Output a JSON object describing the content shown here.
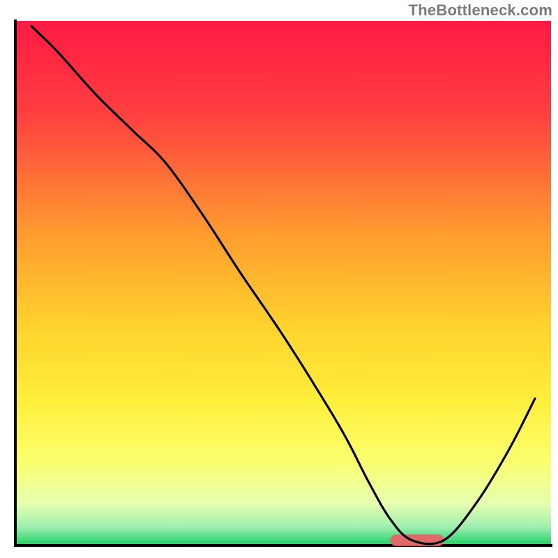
{
  "watermark": "TheBottleneck.com",
  "chart_data": {
    "type": "line",
    "title": "",
    "xlabel": "",
    "ylabel": "",
    "xlim": [
      0,
      100
    ],
    "ylim": [
      0,
      100
    ],
    "legend": false,
    "grid": false,
    "background_gradient": {
      "stops": [
        {
          "offset": 0.0,
          "color": "#ff1a44"
        },
        {
          "offset": 0.18,
          "color": "#ff4040"
        },
        {
          "offset": 0.4,
          "color": "#ff9a2f"
        },
        {
          "offset": 0.58,
          "color": "#ffd22e"
        },
        {
          "offset": 0.72,
          "color": "#ffee3a"
        },
        {
          "offset": 0.84,
          "color": "#fbff6e"
        },
        {
          "offset": 0.92,
          "color": "#e6ffb0"
        },
        {
          "offset": 0.965,
          "color": "#9eefb0"
        },
        {
          "offset": 1.0,
          "color": "#1ccf62"
        }
      ]
    },
    "series": [
      {
        "name": "bottleneck-curve",
        "type": "line",
        "color": "#000000",
        "x": [
          3,
          8,
          15,
          22,
          28,
          35,
          42,
          50,
          58,
          62,
          66,
          70,
          74,
          80,
          86,
          92,
          97
        ],
        "y": [
          99,
          94,
          86,
          79,
          73,
          63,
          52,
          40,
          27,
          20,
          12,
          5,
          1,
          1,
          8,
          18,
          28
        ]
      }
    ],
    "marker": {
      "name": "optimal-range",
      "shape": "rounded-bar",
      "color": "#e06a6a",
      "x_start": 70,
      "x_end": 80,
      "y": 1,
      "height": 2.2
    },
    "axes": {
      "color": "#000000",
      "thickness_px": 4
    }
  }
}
